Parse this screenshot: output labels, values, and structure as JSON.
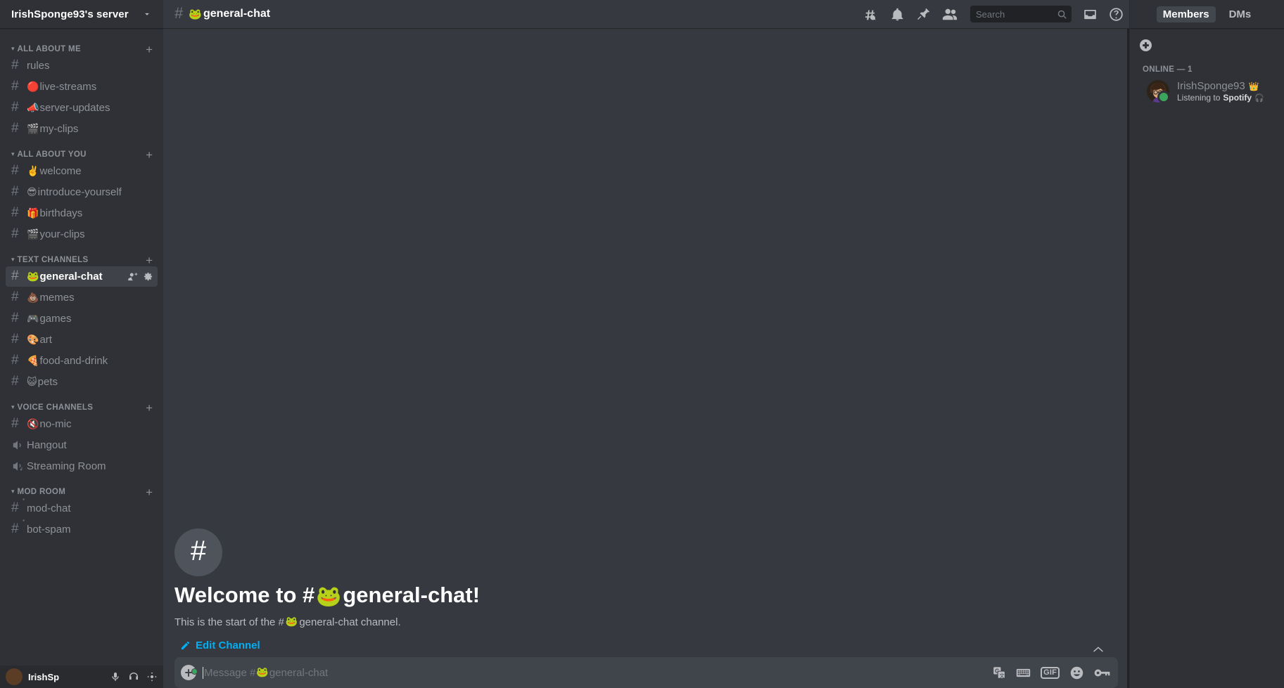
{
  "server": {
    "name": "IrishSponge93's server",
    "dropdown_icon": "chevron-down-icon"
  },
  "sidebar": {
    "categories": [
      {
        "label": "ALL ABOUT ME",
        "add_label": "+",
        "channels": [
          {
            "emoji": "",
            "name": "rules",
            "type": "text",
            "active": false
          },
          {
            "emoji": "🔴",
            "name": "live-streams",
            "type": "text",
            "active": false
          },
          {
            "emoji": "📣",
            "name": "server-updates",
            "type": "text",
            "active": false
          },
          {
            "emoji": "🎬",
            "name": "my-clips",
            "type": "text",
            "active": false
          }
        ]
      },
      {
        "label": "ALL ABOUT YOU",
        "add_label": "+",
        "channels": [
          {
            "emoji": "✌️",
            "name": "welcome",
            "type": "text",
            "active": false
          },
          {
            "emoji": "😎",
            "name": "introduce-yourself",
            "type": "text",
            "active": false
          },
          {
            "emoji": "🎁",
            "name": "birthdays",
            "type": "text",
            "active": false
          },
          {
            "emoji": "🎬",
            "name": "your-clips",
            "type": "text",
            "active": false
          }
        ]
      },
      {
        "label": "TEXT CHANNELS",
        "add_label": "+",
        "channels": [
          {
            "emoji": "🐸",
            "name": "general-chat",
            "type": "text",
            "active": true,
            "actions": [
              "invite-icon",
              "settings-icon"
            ]
          },
          {
            "emoji": "💩",
            "name": "memes",
            "type": "text",
            "active": false
          },
          {
            "emoji": "🎮",
            "name": "games",
            "type": "text",
            "active": false
          },
          {
            "emoji": "🎨",
            "name": "art",
            "type": "text",
            "active": false
          },
          {
            "emoji": "🍕",
            "name": "food-and-drink",
            "type": "text",
            "active": false
          },
          {
            "emoji": "😺",
            "name": "pets",
            "type": "text",
            "active": false
          }
        ]
      },
      {
        "label": "VOICE CHANNELS",
        "add_label": "+",
        "channels": [
          {
            "emoji": "🔇",
            "name": "no-mic",
            "type": "text",
            "active": false
          },
          {
            "emoji": "",
            "name": "Hangout",
            "type": "voice",
            "active": false
          },
          {
            "emoji": "",
            "name": "Streaming Room",
            "type": "stage",
            "active": false
          }
        ]
      },
      {
        "label": "MOD ROOM",
        "add_label": "+",
        "channels": [
          {
            "emoji": "",
            "name": "mod-chat",
            "type": "private",
            "active": false
          },
          {
            "emoji": "",
            "name": "bot-spam",
            "type": "private",
            "active": false
          }
        ]
      }
    ]
  },
  "user_panel": {
    "name": "IrishSp",
    "icons": [
      "mic-icon",
      "headphones-icon",
      "settings-icon"
    ]
  },
  "top_bar": {
    "hash": "#",
    "channel_emoji": "🐸",
    "channel_name": "general-chat",
    "icons": [
      "threads-icon",
      "bell-icon",
      "pin-icon",
      "members-icon",
      "inbox-icon",
      "help-icon"
    ],
    "search": {
      "placeholder": "Search",
      "value": "",
      "icon": "search-icon"
    }
  },
  "main": {
    "welcome_hash": "#",
    "welcome_prefix": "Welcome to #",
    "welcome_emoji": "🐸",
    "welcome_suffix": "general-chat!",
    "start_prefix": "This is the start of the #",
    "start_emoji": "🐸",
    "start_suffix": "general-chat channel.",
    "edit_channel_label": "Edit Channel",
    "edit_channel_icon": "pencil-icon",
    "edit_channel_color": "#00aff4",
    "jump_to_present_icon": "chevron-up-icon"
  },
  "composer": {
    "placeholder_prefix": "Message #",
    "placeholder_emoji": "🐸",
    "placeholder_suffix": "general-chat",
    "value": "",
    "attach_icon": "plus-circle-icon",
    "icons": [
      "google-translate-icon",
      "keyboard-icon",
      "gif-icon",
      "emoji-icon",
      "nitro-key-icon"
    ],
    "gif_label": "GIF"
  },
  "members_panel": {
    "tabs": [
      {
        "label": "Members",
        "active": true
      },
      {
        "label": "DMs",
        "active": false
      }
    ],
    "add_member_icon": "add-member-icon",
    "group_label": "ONLINE — 1",
    "members": [
      {
        "name": "IrishSponge93",
        "badge": "👑",
        "activity_prefix": "Listening to",
        "activity_app": "Spotify",
        "activity_icon": "🎧",
        "status": "online",
        "status_color": "#3ba55d"
      }
    ]
  },
  "colors": {
    "sidebar_bg": "#2f3136",
    "main_bg": "#36393f",
    "active_channel_bg": "#3f4248",
    "accent_link": "#00aff4",
    "online_green": "#3ba55d",
    "composer_bg": "#40444b"
  }
}
